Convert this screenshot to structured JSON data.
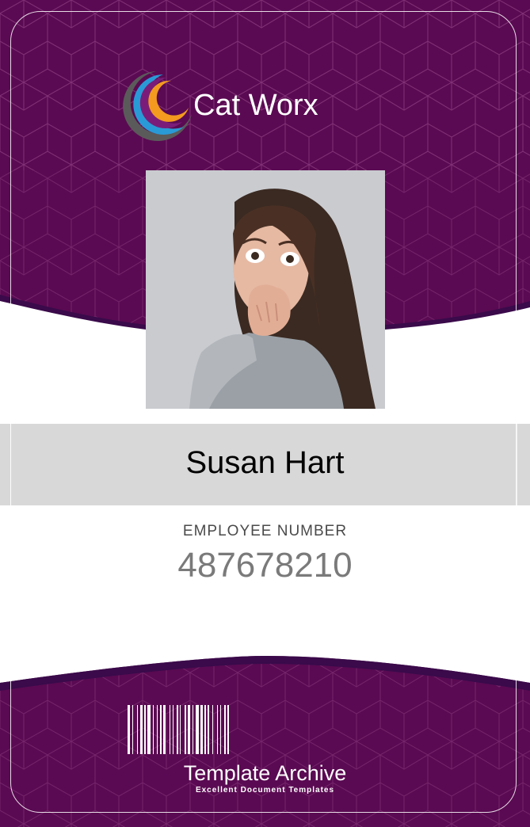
{
  "company": {
    "name": "Cat Worx",
    "logo_icon": "crescent-rings-icon"
  },
  "photo": {
    "alt": "employee-photo"
  },
  "employee": {
    "name": "Susan Hart",
    "number_label": "EMPLOYEE NUMBER",
    "number": "487678210"
  },
  "footer": {
    "brand": "Template Archive",
    "tagline": "Excellent Document Templates",
    "barcode_icon": "barcode-icon"
  },
  "colors": {
    "primary_purple": "#5a0a52",
    "dark_purple": "#3a0a4a",
    "band_gray": "#d8d8d8",
    "logo_orange": "#f39a1f",
    "logo_blue": "#2a9ad6",
    "logo_purple": "#7a1d7a",
    "logo_gray": "#5a5a5a"
  }
}
